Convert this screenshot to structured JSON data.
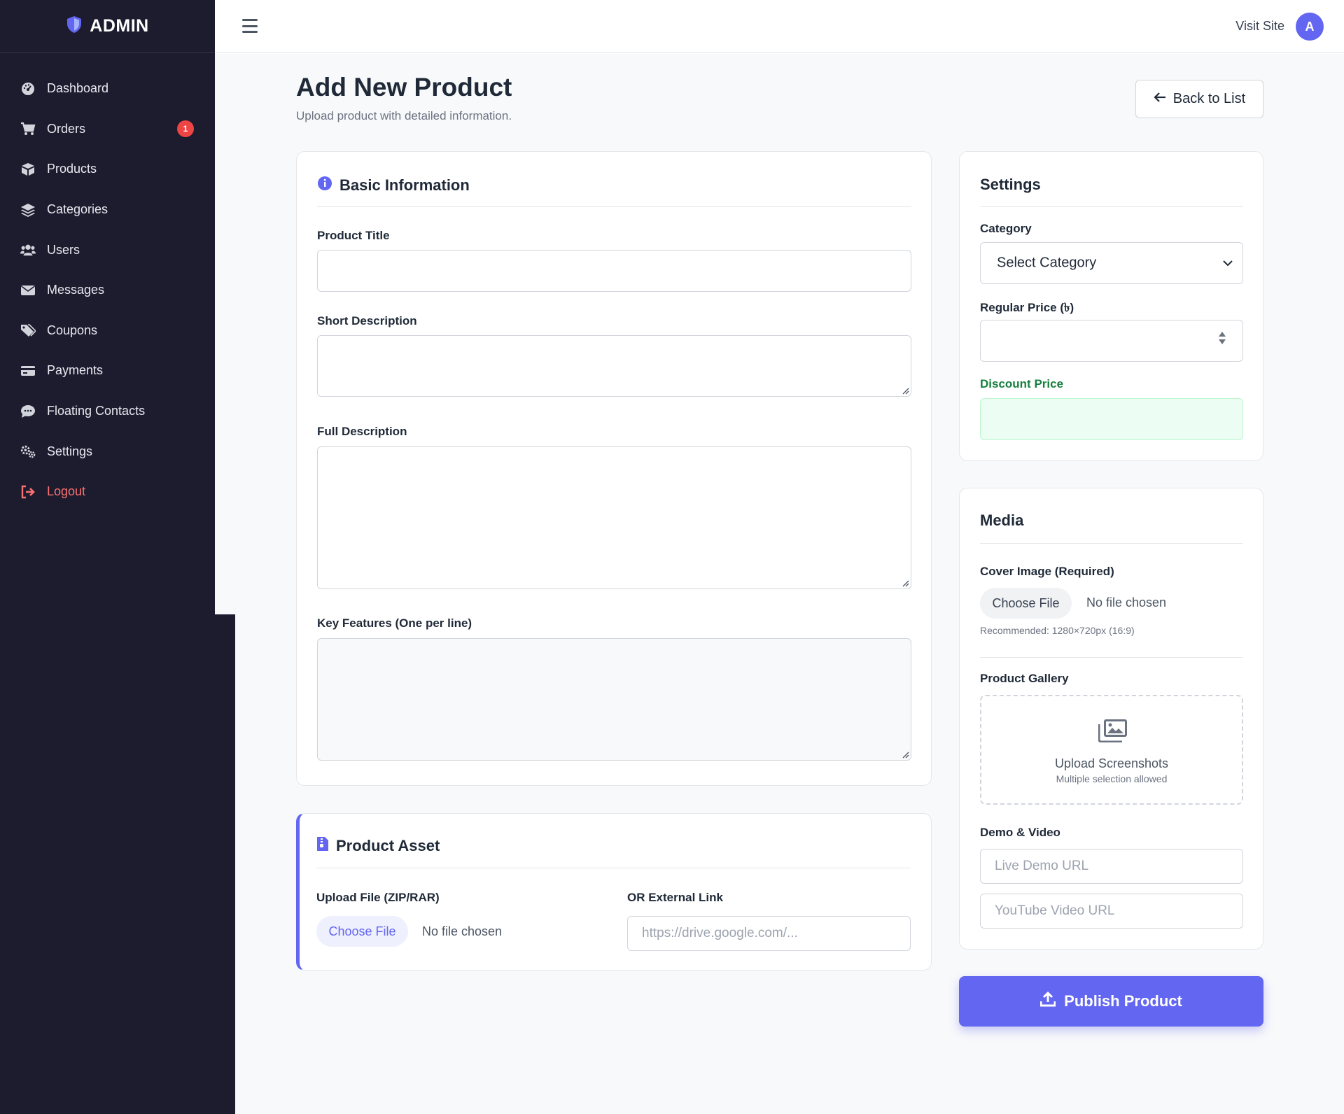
{
  "brand": {
    "name": "ADMIN",
    "icon": "shield-icon"
  },
  "sidebar": {
    "items": [
      {
        "label": "Dashboard",
        "icon": "dashboard-icon"
      },
      {
        "label": "Orders",
        "icon": "cart-icon",
        "badge": "1"
      },
      {
        "label": "Products",
        "icon": "box-icon"
      },
      {
        "label": "Categories",
        "icon": "layers-icon"
      },
      {
        "label": "Users",
        "icon": "users-icon"
      },
      {
        "label": "Messages",
        "icon": "envelope-icon"
      },
      {
        "label": "Coupons",
        "icon": "tags-icon"
      },
      {
        "label": "Payments",
        "icon": "credit-card-icon"
      },
      {
        "label": "Floating Contacts",
        "icon": "chat-icon"
      },
      {
        "label": "Settings",
        "icon": "gears-icon"
      },
      {
        "label": "Logout",
        "icon": "logout-icon"
      }
    ]
  },
  "topbar": {
    "visit_site": "Visit Site",
    "avatar_initial": "A"
  },
  "page": {
    "title": "Add New Product",
    "subtitle": "Upload product with detailed information.",
    "back_button": "Back to List"
  },
  "basic_info": {
    "title": "Basic Information",
    "product_title_label": "Product Title",
    "short_desc_label": "Short Description",
    "full_desc_label": "Full Description",
    "key_features_label": "Key Features (One per line)"
  },
  "asset": {
    "title": "Product Asset",
    "upload_label": "Upload File (ZIP/RAR)",
    "choose_file": "Choose File",
    "no_file": "No file chosen",
    "external_label": "OR External Link",
    "external_placeholder": "https://drive.google.com/..."
  },
  "settings": {
    "title": "Settings",
    "category_label": "Category",
    "category_value": "Select Category",
    "regular_price_label": "Regular Price (৳)",
    "discount_label": "Discount Price"
  },
  "media": {
    "title": "Media",
    "cover_label": "Cover Image (Required)",
    "choose_file": "Choose File",
    "no_file": "No file chosen",
    "recommended": "Recommended: 1280×720px (16:9)",
    "gallery_label": "Product Gallery",
    "gallery_title": "Upload Screenshots",
    "gallery_sub": "Multiple selection allowed",
    "demo_label": "Demo & Video",
    "demo_placeholder": "Live Demo URL",
    "youtube_placeholder": "YouTube Video URL"
  },
  "publish_button": "Publish Product",
  "colors": {
    "sidebar_bg": "#1d1c2f",
    "accent": "#6366f1",
    "badge": "#ef4444",
    "logout": "#f87171",
    "discount_label": "#15803d",
    "discount_bg": "#ecfdf3"
  }
}
